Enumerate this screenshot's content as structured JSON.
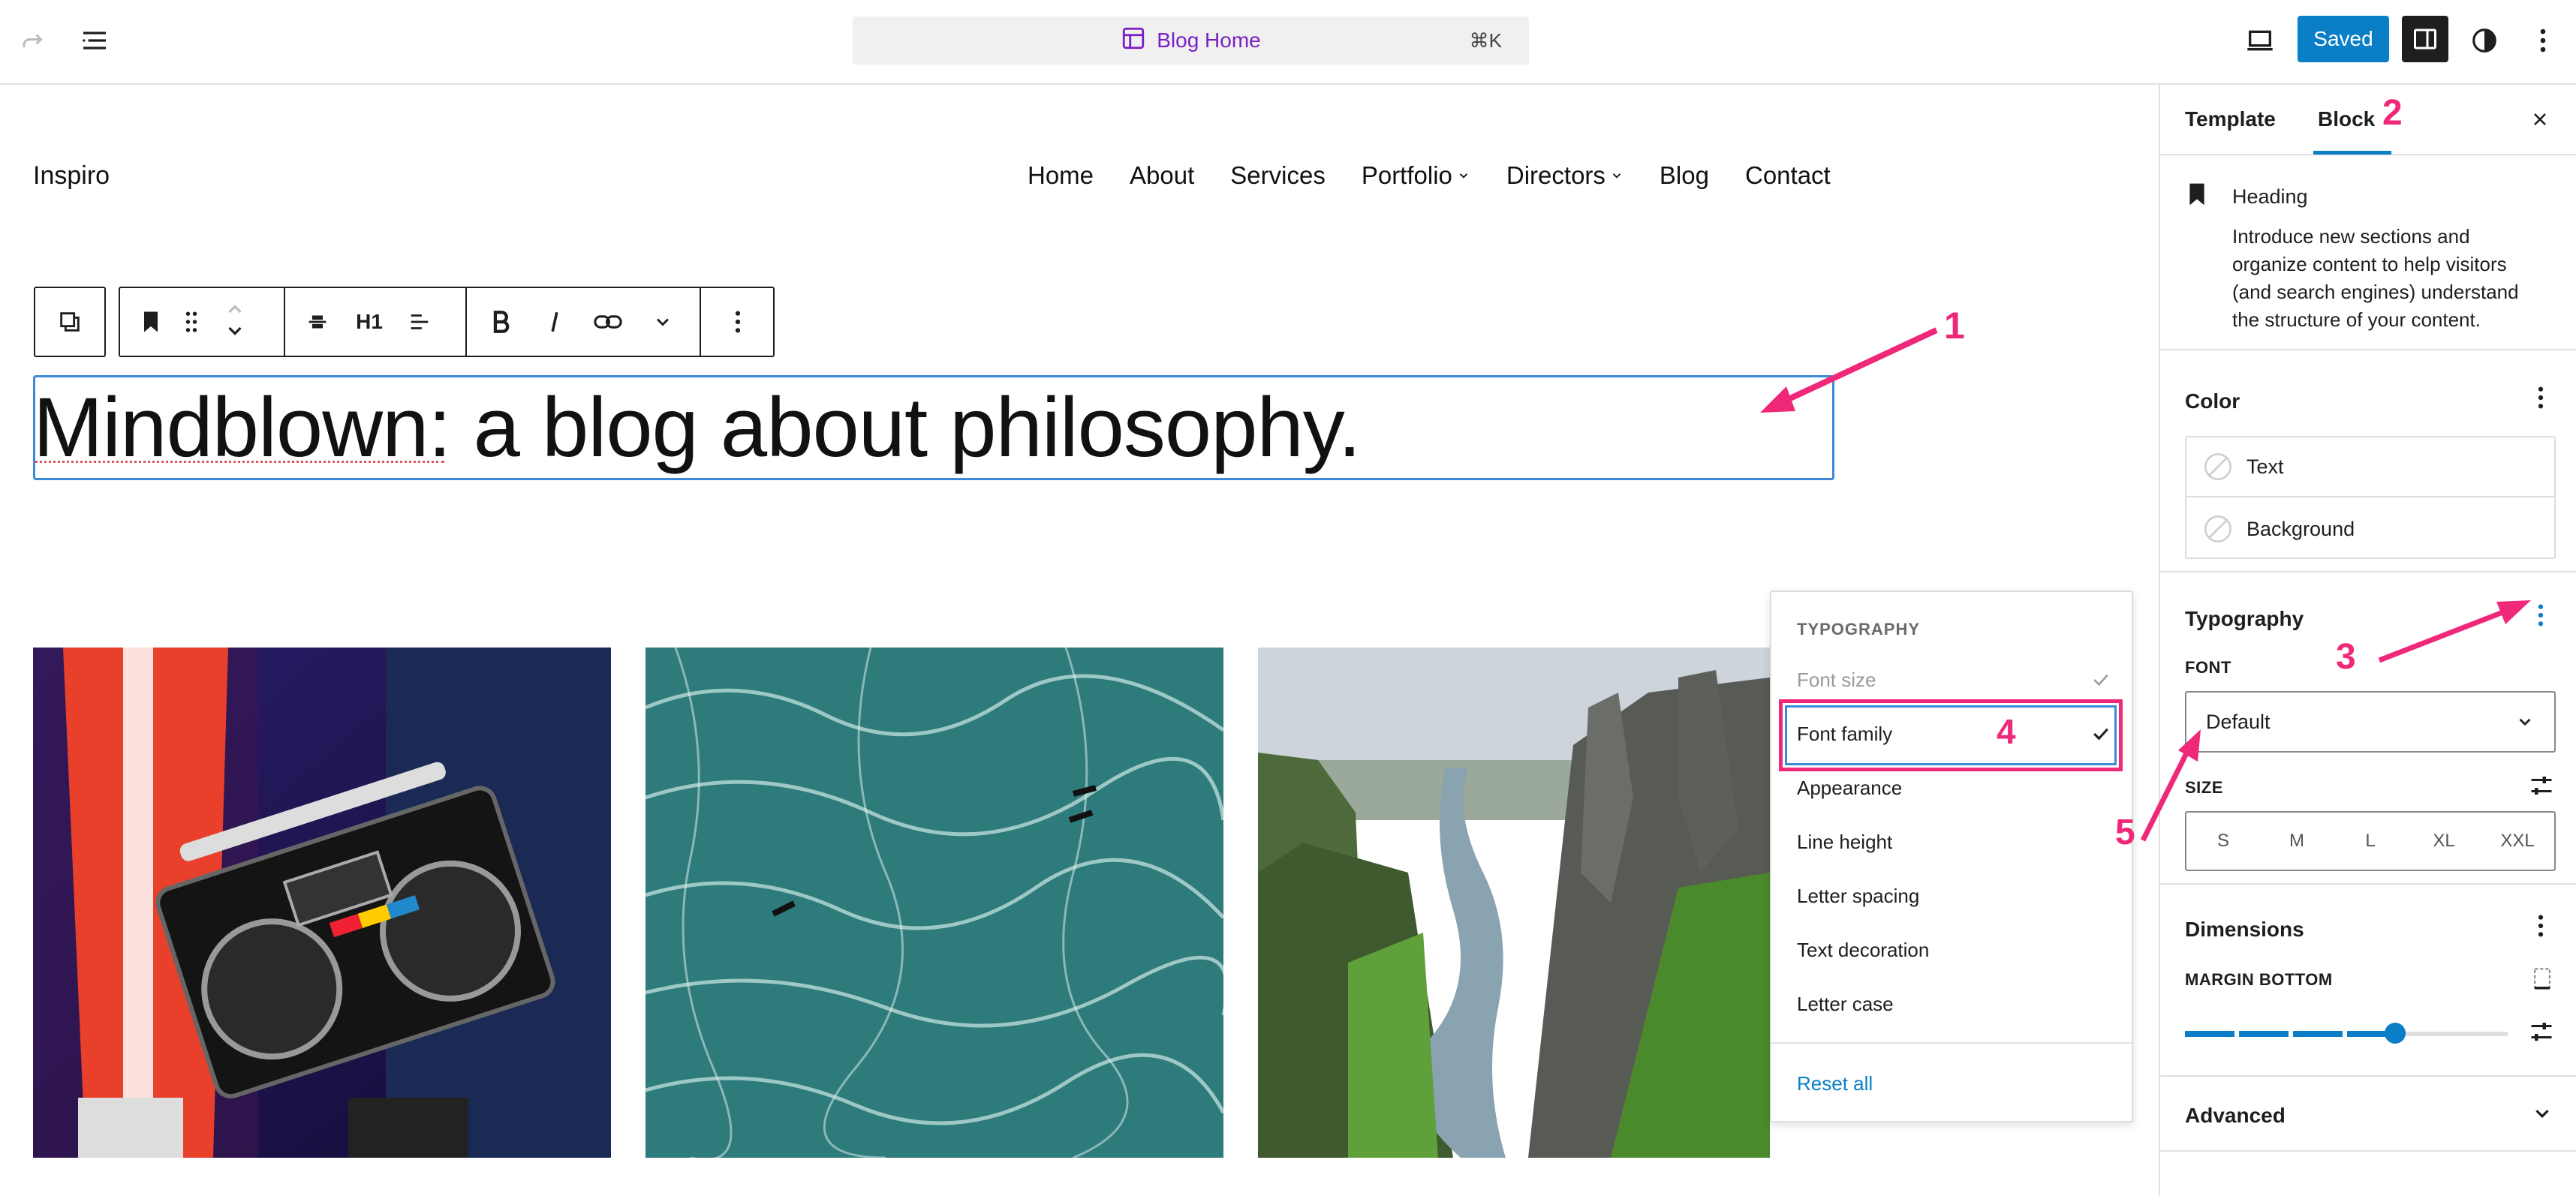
{
  "topbar": {
    "command_title": "Blog Home",
    "command_shortcut": "⌘K",
    "saved_label": "Saved"
  },
  "site": {
    "title": "Inspiro",
    "nav": [
      "Home",
      "About",
      "Services",
      "Portfolio",
      "Directors",
      "Blog",
      "Contact"
    ]
  },
  "block_toolbar": {
    "heading_level": "H1"
  },
  "heading_text": "Mindblown: a blog about philosophy.",
  "typography_menu": {
    "header": "TYPOGRAPHY",
    "items": [
      "Font size",
      "Font family",
      "Appearance",
      "Line height",
      "Letter spacing",
      "Text decoration",
      "Letter case"
    ],
    "reset_label": "Reset all"
  },
  "sidebar": {
    "tabs": [
      "Template",
      "Block"
    ],
    "block_card": {
      "title": "Heading",
      "description": "Introduce new sections and organize content to help visitors (and search engines) understand the structure of your content."
    },
    "color": {
      "title": "Color",
      "items": [
        "Text",
        "Background"
      ]
    },
    "typography": {
      "title": "Typography",
      "font_label": "FONT",
      "font_value": "Default",
      "size_label": "SIZE",
      "sizes": [
        "S",
        "M",
        "L",
        "XL",
        "XXL"
      ]
    },
    "dimensions": {
      "title": "Dimensions",
      "margin_label": "MARGIN BOTTOM",
      "margin_level": 0.65
    },
    "advanced": {
      "title": "Advanced"
    }
  },
  "annotations": [
    "1",
    "2",
    "3",
    "4",
    "5"
  ],
  "colors": {
    "accent": "#0a7ec6",
    "annotation": "#f0287a",
    "command_title": "#7a1fc4",
    "selection": "#3b8ad6"
  }
}
